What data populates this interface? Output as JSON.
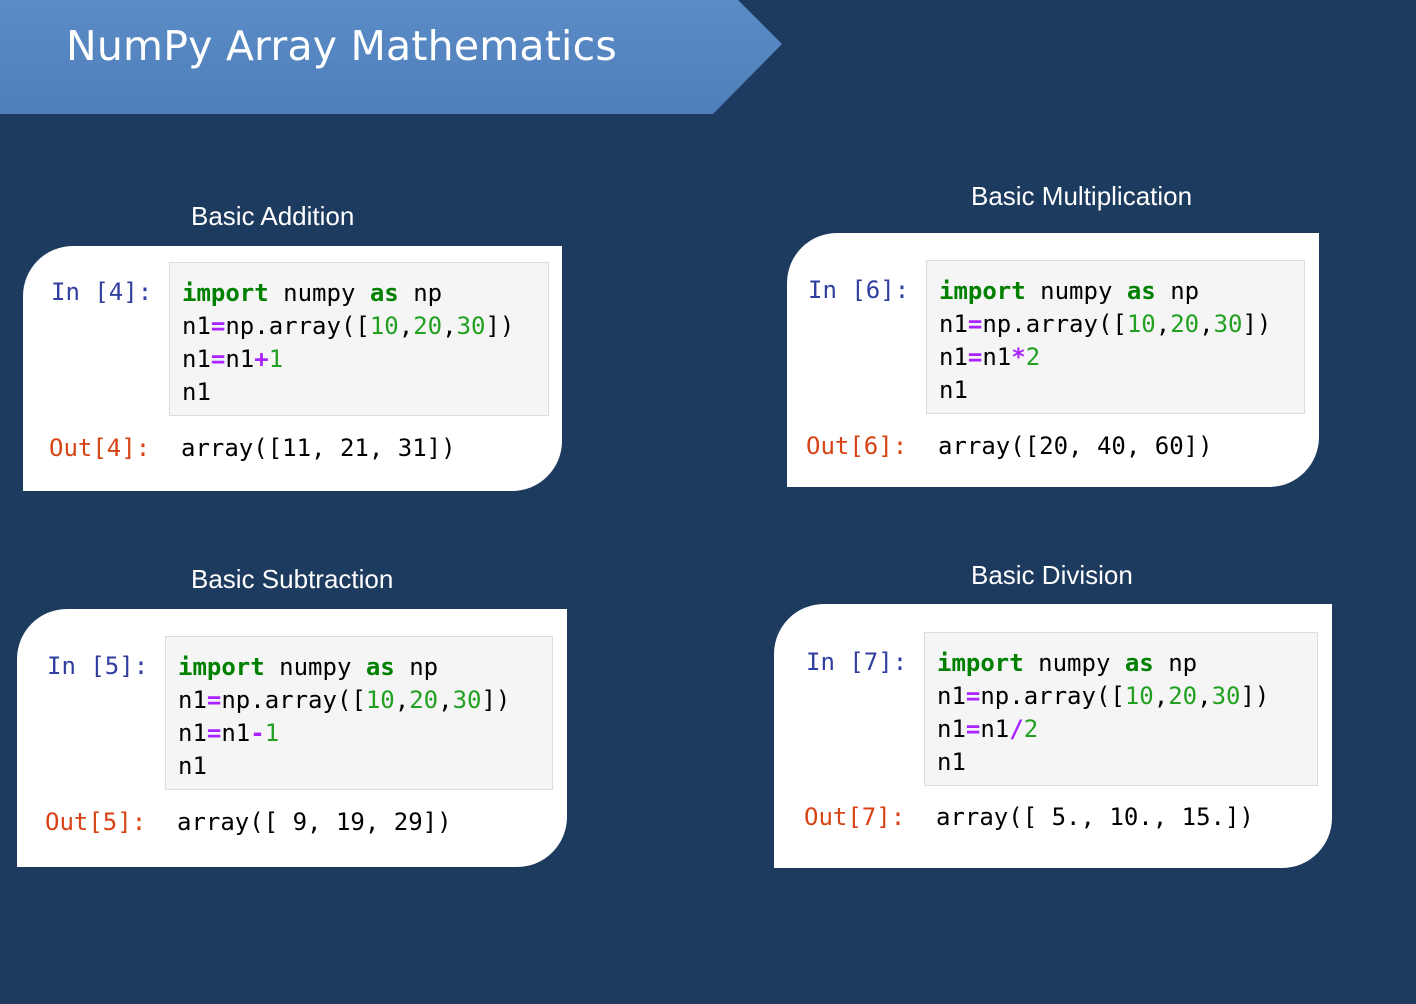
{
  "title": "NumPy Array Mathematics",
  "cells": [
    {
      "label": "Basic Addition",
      "in_prompt": "In [4]:",
      "out_prompt": "Out[4]:",
      "code": {
        "kw_import": "import",
        "mod": " numpy ",
        "kw_as": "as",
        "alias": " np",
        "assign_prefix": "n1",
        "eq": "=",
        "array_call": "np.array([",
        "n10": "10",
        "n20": "20",
        "n30": "30",
        "comma": ",",
        "close": "])",
        "line3_lhs": "n1",
        "line3_rhs": "n1",
        "operator": "+",
        "operand": "1",
        "line4": "n1"
      },
      "output": "array([11, 21, 31])"
    },
    {
      "label": "Basic Multiplication",
      "in_prompt": "In [6]:",
      "out_prompt": "Out[6]:",
      "code": {
        "kw_import": "import",
        "mod": " numpy ",
        "kw_as": "as",
        "alias": " np",
        "assign_prefix": "n1",
        "eq": "=",
        "array_call": "np.array([",
        "n10": "10",
        "n20": "20",
        "n30": "30",
        "comma": ",",
        "close": "])",
        "line3_lhs": "n1",
        "line3_rhs": "n1",
        "operator": "*",
        "operand": "2",
        "line4": "n1"
      },
      "output": "array([20, 40, 60])"
    },
    {
      "label": "Basic Subtraction",
      "in_prompt": "In [5]:",
      "out_prompt": "Out[5]:",
      "code": {
        "kw_import": "import",
        "mod": " numpy ",
        "kw_as": "as",
        "alias": " np",
        "assign_prefix": "n1",
        "eq": "=",
        "array_call": "np.array([",
        "n10": "10",
        "n20": "20",
        "n30": "30",
        "comma": ",",
        "close": "])",
        "line3_lhs": "n1",
        "line3_rhs": "n1",
        "operator": "-",
        "operand": "1",
        "line4": "n1"
      },
      "output": "array([ 9, 19, 29])"
    },
    {
      "label": "Basic Division",
      "in_prompt": "In [7]:",
      "out_prompt": "Out[7]:",
      "code": {
        "kw_import": "import",
        "mod": " numpy ",
        "kw_as": "as",
        "alias": " np",
        "assign_prefix": "n1",
        "eq": "=",
        "array_call": "np.array([",
        "n10": "10",
        "n20": "20",
        "n30": "30",
        "comma": ",",
        "close": "])",
        "line3_lhs": "n1",
        "line3_rhs": "n1",
        "operator": "/",
        "operand": "2",
        "line4": "n1"
      },
      "output": "array([ 5., 10., 15.])"
    }
  ],
  "colors": {
    "background": "#1d3a5f",
    "banner": "#5b8cc6",
    "keyword": "#008000",
    "number": "#22a022",
    "operator": "#aa22ff",
    "in_prompt": "#303f9f",
    "out_prompt": "#d84315"
  }
}
